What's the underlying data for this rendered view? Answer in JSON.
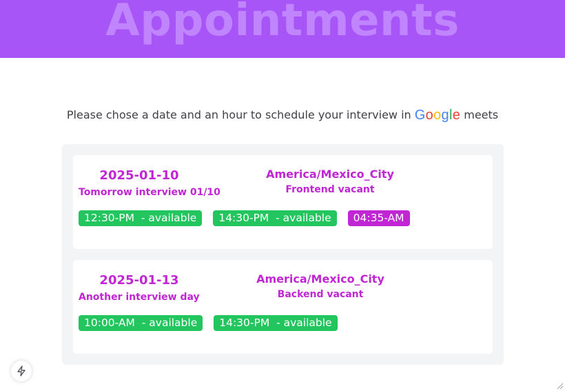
{
  "header": {
    "title": "Appointments",
    "background_color": "#a855f7",
    "title_color": "#c084fc"
  },
  "instruction": {
    "text_before": "Please chose a date and an hour to schedule your interview in",
    "brand": [
      "G",
      "o",
      "o",
      "g",
      "l",
      "e"
    ],
    "text_after": "meets"
  },
  "appointments": [
    {
      "date": "2025-01-10",
      "note": "Tomorrow interview 01/10",
      "timezone": "America/Mexico_City",
      "vacancy": "Frontend vacant",
      "slots": [
        {
          "label": "12:30-PM  - available",
          "state": "available"
        },
        {
          "label": "14:30-PM  - available",
          "state": "available"
        },
        {
          "label": "04:35-AM",
          "state": "selected"
        }
      ]
    },
    {
      "date": "2025-01-13",
      "note": "Another interview day",
      "timezone": "America/Mexico_City",
      "vacancy": "Backend vacant",
      "slots": [
        {
          "label": "10:00-AM  - available",
          "state": "available"
        },
        {
          "label": "14:30-PM  - available",
          "state": "available"
        }
      ]
    }
  ],
  "colors": {
    "accent": "#c026d3",
    "available": "#22c55e",
    "panel": "#f3f4f6"
  },
  "icons": {
    "floating_button": "lightning-bolt-icon",
    "corner": "resize-grip-icon"
  }
}
